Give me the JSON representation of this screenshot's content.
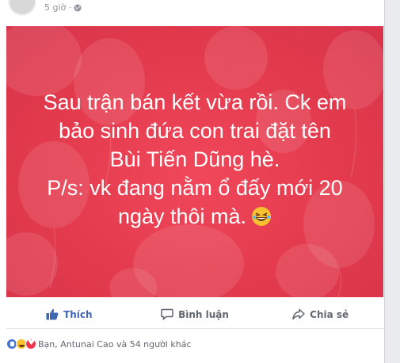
{
  "post": {
    "timestamp": "5 giờ ·",
    "image_text_lines": [
      "Sau trận bán kết vừa rồi. Ck em",
      "bảo sinh đứa con trai đặt tên",
      "Bùi Tiến Dũng hè.",
      "P/s: vk đang nằm ổ đấy mới 20",
      "ngày thôi mà."
    ],
    "image_background": "#e33b4d"
  },
  "actions": {
    "like_label": "Thích",
    "comment_label": "Bình luận",
    "share_label": "Chia sẻ"
  },
  "reactions": {
    "summary": "Bạn, Antunai Cao và 54 người khác",
    "icons": [
      "like-icon",
      "haha-icon",
      "love-icon"
    ]
  },
  "colors": {
    "accent": "#4267b2",
    "muted": "#606770"
  }
}
